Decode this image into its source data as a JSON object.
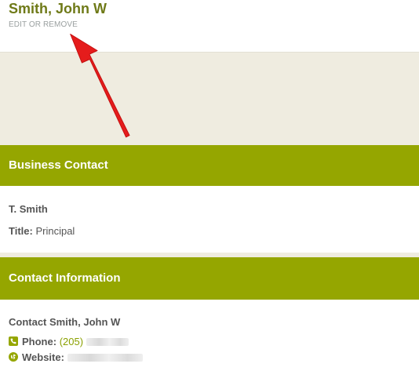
{
  "header": {
    "title": "Smith, John W",
    "edit_link": "EDIT OR REMOVE"
  },
  "business_contact": {
    "heading": "Business Contact",
    "name": "T. Smith",
    "title_label": "Title:",
    "title_value": "Principal"
  },
  "contact_information": {
    "heading": "Contact Information",
    "contact_name": "Contact Smith, John W",
    "phone_label": "Phone:",
    "phone_value": "(205)",
    "website_label": "Website:"
  },
  "colors": {
    "title": "#6f7a18",
    "section_header": "#95a600",
    "banner": "#efece0",
    "arrow": "#e51c1c",
    "link": "#8aa000"
  },
  "icons": {
    "phone": "phone-icon",
    "website": "globe-icon",
    "annotation": "red-arrow-icon"
  }
}
